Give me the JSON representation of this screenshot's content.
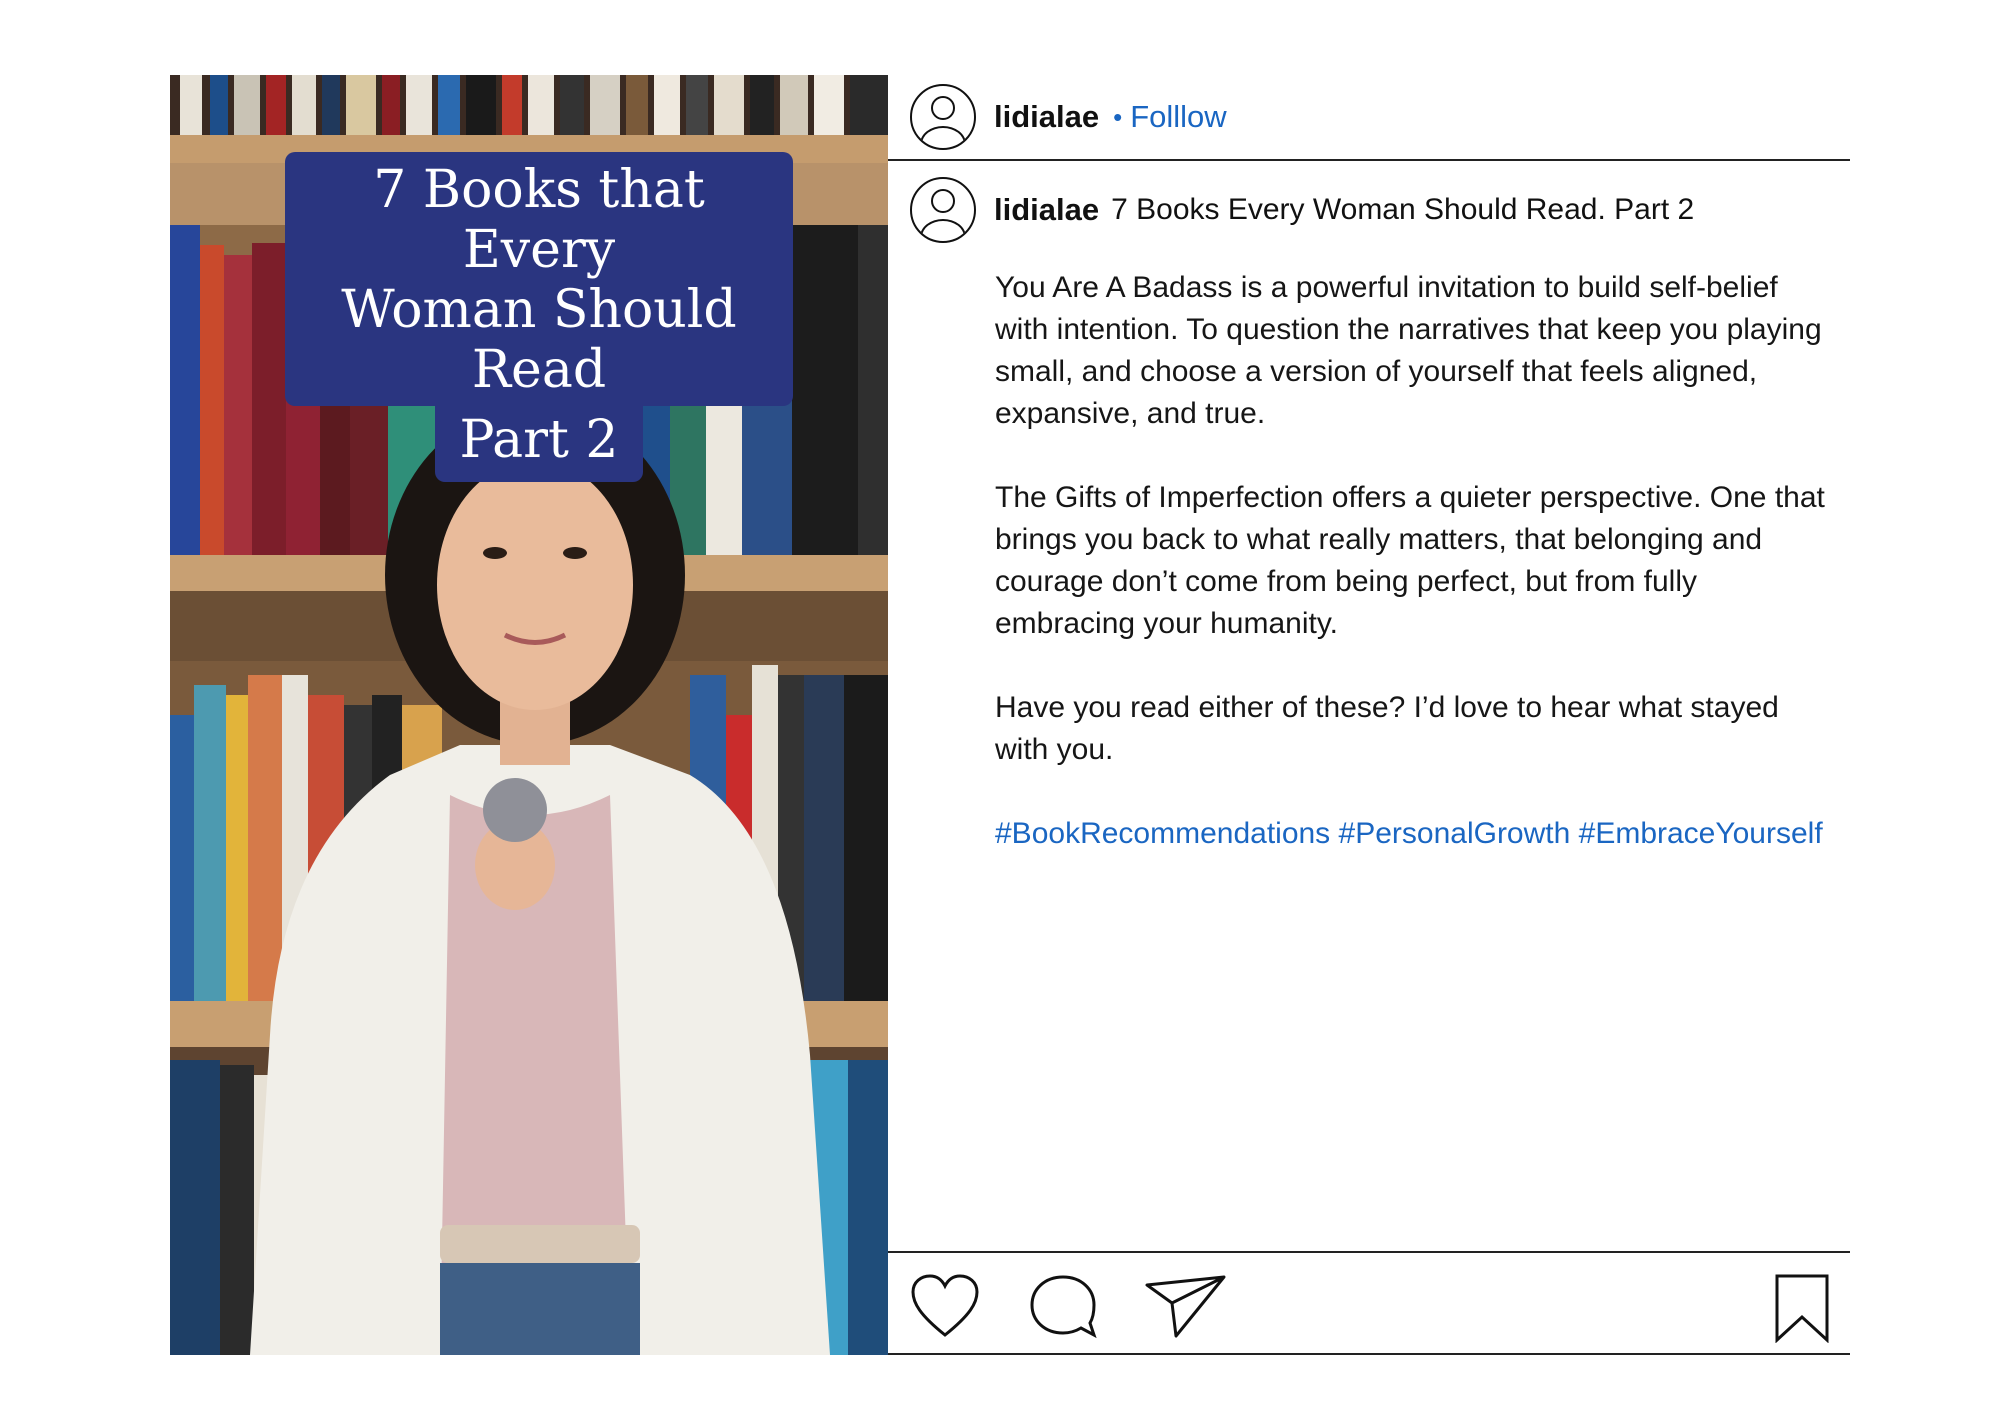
{
  "post": {
    "username": "lidialae",
    "follow_dot": "•",
    "follow_label": "Folllow",
    "image_overlay": {
      "line1": "7 Books that Every",
      "line2": "Woman Should Read",
      "line3": "Part 2"
    },
    "caption": {
      "username": "lidialae",
      "title": "7 Books Every Woman Should Read. Part 2",
      "paragraph1": "You Are A Badass is a powerful invitation to build self-belief with intention. To question the narratives that keep you playing small, and choose a version of yourself that feels aligned, expansive, and true.",
      "paragraph2": "The Gifts of Imperfection offers a quieter perspective. One that brings you back to what really matters, that belonging and courage don’t come from being perfect, but from fully embracing your humanity.",
      "paragraph3": "Have you read either of these? I’d love to hear what stayed with you.",
      "hashtags": "#BookRecommendations #PersonalGrowth #EmbraceYourself"
    },
    "actions": {
      "icons": [
        "heart-icon",
        "comment-icon",
        "share-icon",
        "bookmark-icon"
      ]
    }
  },
  "colors": {
    "link": "#1a66c2",
    "overlay_band": "#2a3580",
    "text": "#111111",
    "background": "#ffffff"
  }
}
